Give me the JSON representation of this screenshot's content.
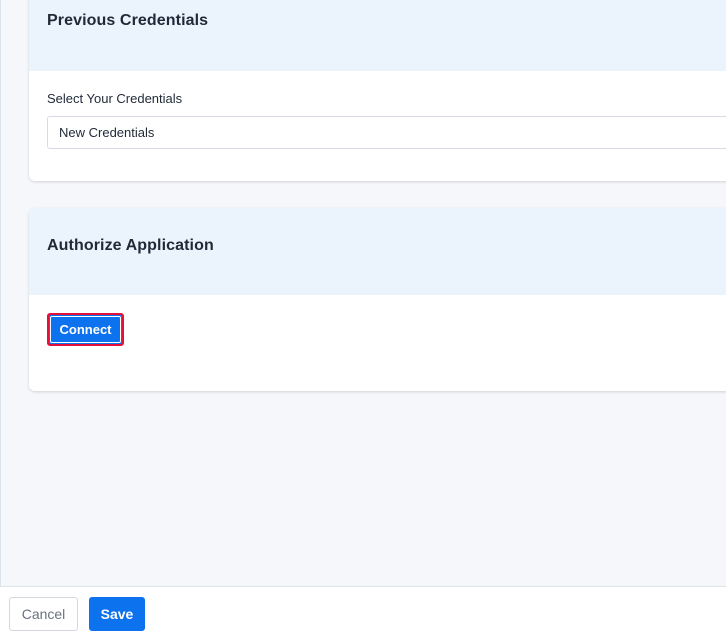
{
  "previous_credentials": {
    "title": "Previous Credentials",
    "select_label": "Select Your Credentials",
    "select_value": "New Credentials"
  },
  "authorize": {
    "title": "Authorize Application",
    "connect_label": "Connect"
  },
  "footer": {
    "cancel_label": "Cancel",
    "save_label": "Save"
  },
  "colors": {
    "primary": "#0d72ee",
    "highlight_border": "#e3103b",
    "header_bg": "#ebf4fd",
    "page_bg": "#f5f7fa"
  }
}
